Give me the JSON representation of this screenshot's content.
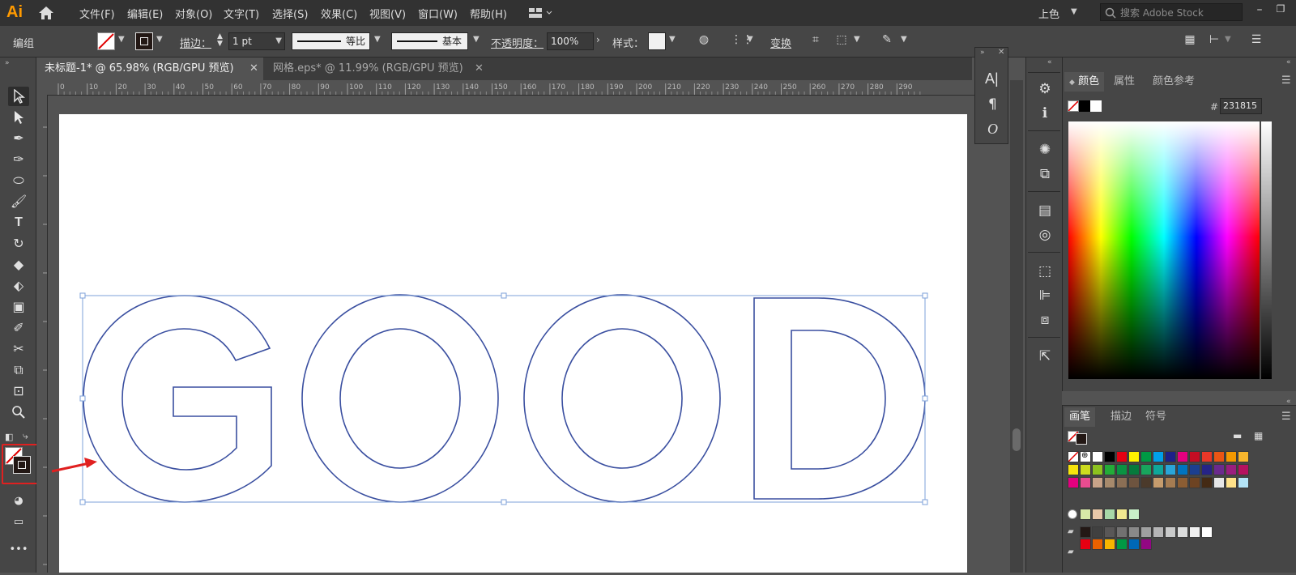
{
  "menubar": {
    "app_logo": "Ai",
    "menus": [
      "文件(F)",
      "编辑(E)",
      "对象(O)",
      "文字(T)",
      "选择(S)",
      "效果(C)",
      "视图(V)",
      "窗口(W)",
      "帮助(H)"
    ],
    "workspace": "上色",
    "search_placeholder": "搜索 Adobe Stock"
  },
  "controlbar": {
    "selection_label": "编组",
    "stroke_label": "描边：",
    "stroke_weight": "1 pt",
    "profile_label": "等比",
    "brush_label": "基本",
    "opacity_label": "不透明度：",
    "opacity_value": "100%",
    "style_label": "样式：",
    "transform_label": "变换"
  },
  "tabs": [
    {
      "label": "未标题-1* @ 65.98% (RGB/GPU 预览)",
      "active": true
    },
    {
      "label": "网格.eps* @ 11.99% (RGB/GPU 预览)",
      "active": false
    }
  ],
  "ruler": {
    "ticks": [
      "0",
      "10",
      "20",
      "30",
      "40",
      "50",
      "60",
      "70",
      "80",
      "90",
      "100",
      "110",
      "120",
      "130",
      "140",
      "150",
      "160",
      "170",
      "180",
      "190",
      "200",
      "210",
      "220",
      "230",
      "240",
      "250",
      "260",
      "270",
      "280",
      "290"
    ]
  },
  "canvas": {
    "text": "GOOD",
    "outline_color": "#3a4fa0",
    "selection_color": "#7ea0d8",
    "annotation_color": "#e02020"
  },
  "color_panel": {
    "tabs": [
      "颜色",
      "属性",
      "颜色参考"
    ],
    "hex_label": "#",
    "hex_value": "231815"
  },
  "swatch_panel": {
    "tabs": [
      "画笔",
      "描边",
      "符号"
    ],
    "rows": [
      [
        "#f7e40c",
        "#cddc1f",
        "#8dc21f",
        "#23ac38",
        "#0a9342",
        "#067a3c",
        "#18a55d",
        "#0fa79a",
        "#2aa5d8",
        "#0074bf",
        "#1c3f8f",
        "#262487",
        "#6b2a8d",
        "#9a1e7e",
        "#b5125f"
      ],
      [
        "#e3007f",
        "#e94c90",
        "#c9a389",
        "#a78a6c",
        "#8b6f55",
        "#6e543f",
        "#4b3a2b",
        "#c69c6d",
        "#a57c52",
        "#8b5d33",
        "#6d4322",
        "#442a14",
        "#e6e6e6",
        "#ffe28a",
        "#b3e4f7"
      ],
      [
        "#231815",
        "#404040",
        "#595757",
        "#727171",
        "#898989",
        "#9fa0a0",
        "#b5b5b6",
        "#c9caca",
        "#dcdddd",
        "#efefef",
        "#ffffff"
      ],
      [
        "#e60012",
        "#eb6100",
        "#f8b500",
        "#009944",
        "#0068b7",
        "#920783"
      ]
    ]
  }
}
